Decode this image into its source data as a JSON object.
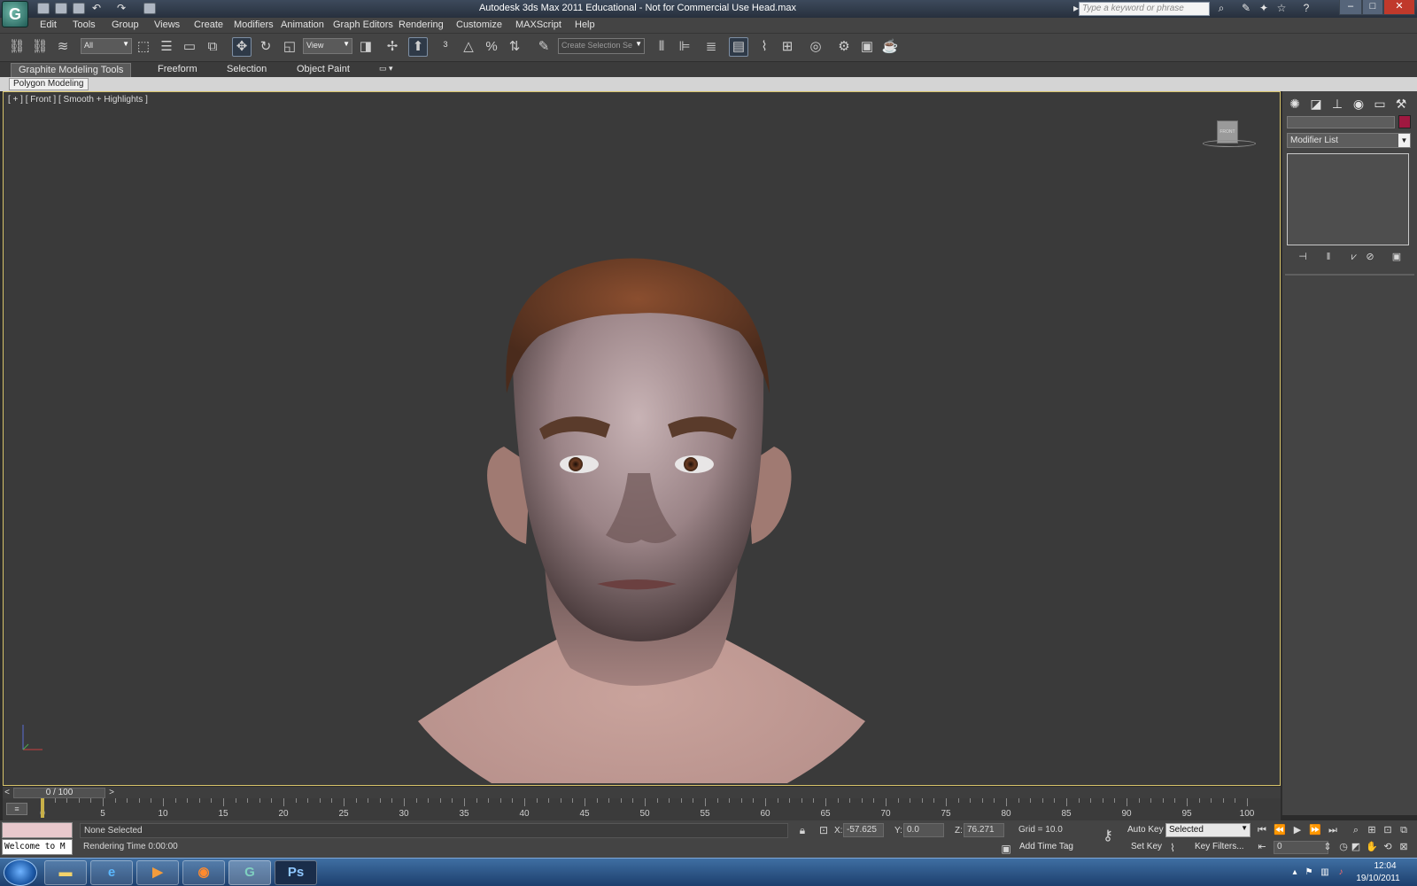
{
  "window": {
    "title": "Autodesk 3ds Max  2011    Educational - Not for Commercial Use    Head.max",
    "search_placeholder": "Type a keyword or phrase"
  },
  "menu": [
    "Edit",
    "Tools",
    "Group",
    "Views",
    "Create",
    "Modifiers",
    "Animation",
    "Graph Editors",
    "Rendering",
    "Customize",
    "MAXScript",
    "Help"
  ],
  "toolbar": {
    "selection_filter": "All",
    "reference_coord": "View",
    "named_selection_placeholder": "Create Selection Se"
  },
  "ribbon": {
    "tabs": [
      "Graphite Modeling Tools",
      "Freeform",
      "Selection",
      "Object Paint"
    ],
    "active_tab": "Graphite Modeling Tools",
    "panel": "Polygon Modeling"
  },
  "viewport": {
    "label": "[ + ] [ Front ] [ Smooth + Highlights ]",
    "viewcube_face": "FRONT"
  },
  "command_panel": {
    "modifier_list": "Modifier List",
    "object_color": "#a01840"
  },
  "timeline": {
    "slider": "0 / 100",
    "ticks": [
      "0",
      "5",
      "10",
      "15",
      "20",
      "25",
      "30",
      "35",
      "40",
      "45",
      "50",
      "55",
      "60",
      "65",
      "70",
      "75",
      "80",
      "85",
      "90",
      "95",
      "100"
    ]
  },
  "status": {
    "listener": "Welcome to M",
    "selection": "None Selected",
    "prompt": "Rendering Time  0:00:00",
    "x_label": "X:",
    "x_value": "-57.625",
    "y_label": "Y:",
    "y_value": "0.0",
    "z_label": "Z:",
    "z_value": "76.271",
    "grid": "Grid = 10.0",
    "add_time_tag": "Add Time Tag",
    "auto_key": "Auto Key",
    "set_key": "Set Key",
    "key_mode": "Selected",
    "key_filters": "Key Filters...",
    "frame": "0"
  },
  "taskbar": {
    "time": "12:04",
    "date": "19/10/2011",
    "apps": [
      "windows-explorer",
      "internet-explorer",
      "media-player",
      "firefox",
      "3ds-max",
      "photoshop"
    ]
  }
}
